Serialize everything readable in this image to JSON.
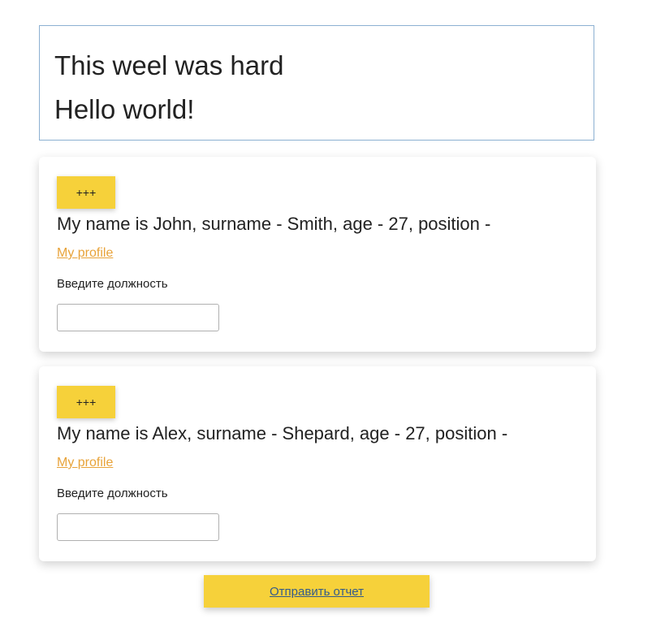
{
  "header": {
    "line1": "This weel was hard",
    "line2": "Hello world!"
  },
  "cards": [
    {
      "button_label": "+++",
      "info": "My name is John, surname - Smith, age - 27, position -",
      "link_label": "My profile",
      "field_label": "Введите должность",
      "field_value": ""
    },
    {
      "button_label": "+++",
      "info": "My name is Alex, surname - Shepard, age - 27, position -",
      "link_label": "My profile",
      "field_label": "Введите должность",
      "field_value": ""
    }
  ],
  "submit": {
    "label": "Отправить отчет"
  },
  "colors": {
    "accent_yellow": "#f6d13a",
    "link_orange": "#e8a33a",
    "header_border": "#8cb0d2",
    "submit_text": "#345b8a"
  }
}
